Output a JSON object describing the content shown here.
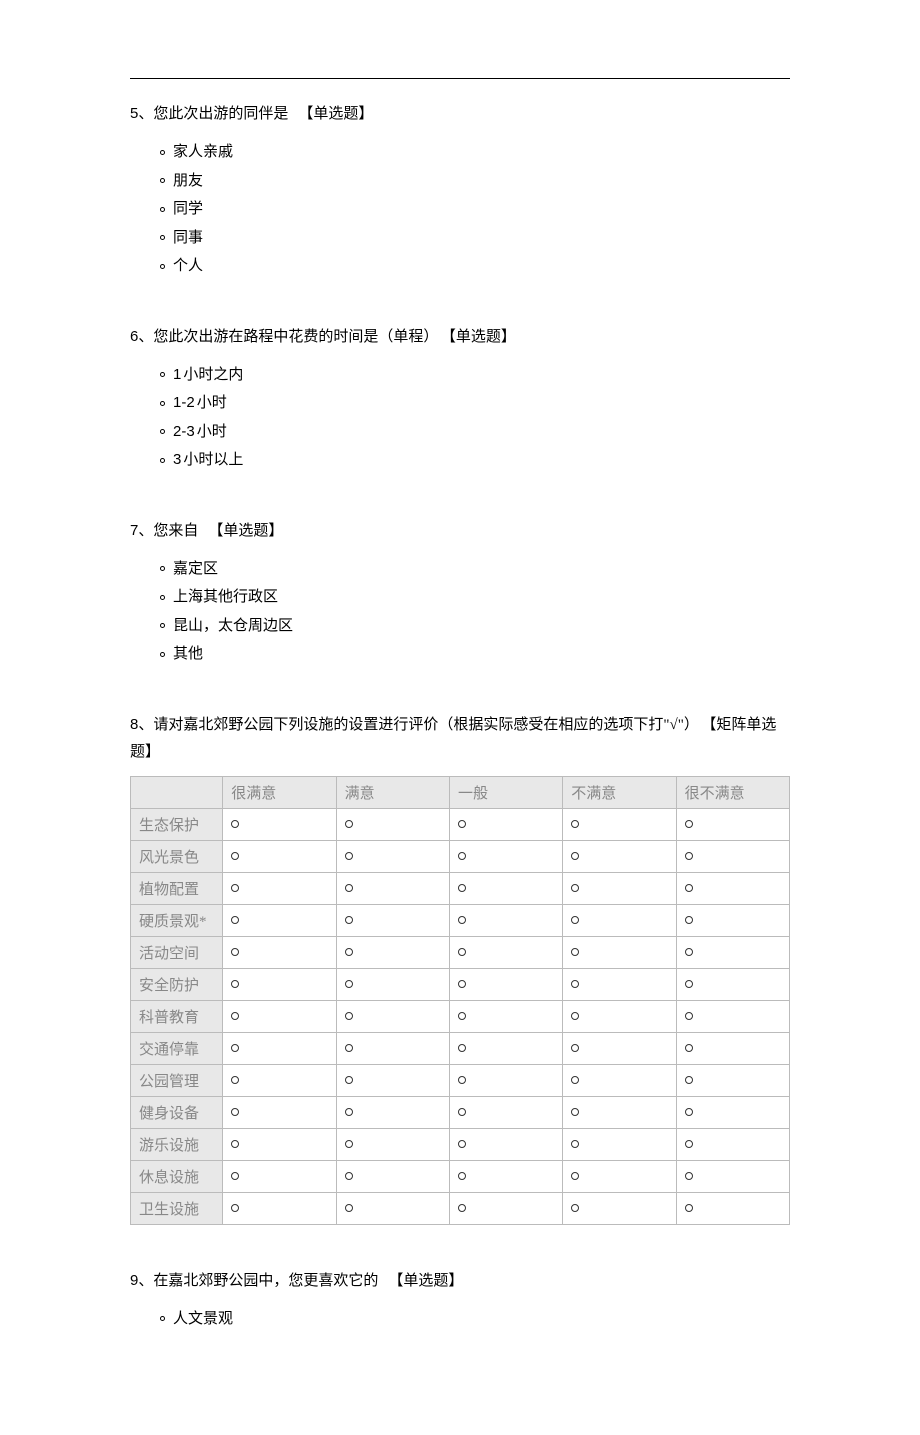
{
  "q5": {
    "num": "5、",
    "text": "您此次出游的同伴是",
    "type": "【单选题】",
    "options": [
      "家人亲戚",
      "朋友",
      "同学",
      "同事",
      "个人"
    ]
  },
  "q6": {
    "num": "6、",
    "text": "您此次出游在路程中花费的时间是（单程）",
    "type": "【单选题】",
    "options_en": [
      "1",
      "1-2",
      "2-3",
      "3"
    ],
    "options_zh": [
      " 小时之内",
      " 小时",
      " 小时",
      " 小时以上"
    ]
  },
  "q7": {
    "num": "7、",
    "text": "您来自",
    "type": "【单选题】",
    "options": [
      "嘉定区",
      "上海其他行政区",
      "昆山，太仓周边区",
      "其他"
    ]
  },
  "q8": {
    "num": "8、",
    "text": "请对嘉北郊野公园下列设施的设置进行评价（根据实际感受在相应的选项下打\"√\"）",
    "type": "【矩阵单选题】",
    "columns": [
      "很满意",
      "满意",
      "一般",
      "不满意",
      "很不满意"
    ],
    "rows": [
      "生态保护",
      "风光景色",
      "植物配置",
      "硬质景观*",
      "活动空间",
      "安全防护",
      "科普教育",
      "交通停靠",
      "公园管理",
      "健身设备",
      "游乐设施",
      "休息设施",
      "卫生设施"
    ]
  },
  "q9": {
    "num": "9、",
    "text": "在嘉北郊野公园中，您更喜欢它的",
    "type": "【单选题】",
    "options": [
      "人文景观"
    ]
  }
}
